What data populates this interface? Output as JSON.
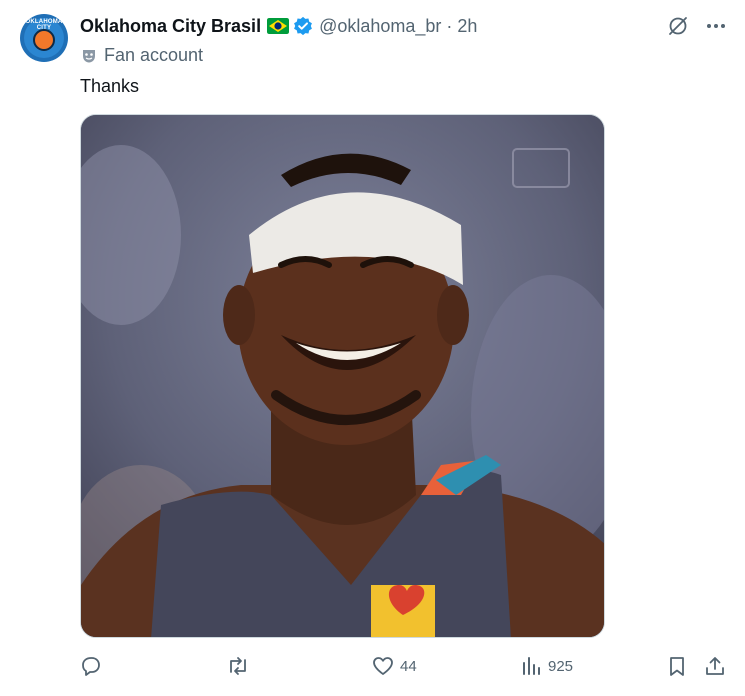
{
  "post": {
    "author": {
      "display_name": "Oklahoma City Brasil",
      "handle": "@oklahoma_br",
      "avatar_text": "OKLAHOMA CITY",
      "flag": "brazil-flag-icon",
      "verified": true
    },
    "separator": "·",
    "time": "2h",
    "label": {
      "icon": "fan-mask-icon",
      "text": "Fan account"
    },
    "text": "Thanks",
    "media": {
      "type": "photo",
      "description_icon": "photo"
    },
    "actions": {
      "reply": {
        "icon": "reply-icon",
        "count": ""
      },
      "repost": {
        "icon": "repost-icon",
        "count": ""
      },
      "like": {
        "icon": "heart-icon",
        "count": "44"
      },
      "views": {
        "icon": "views-icon",
        "count": "925"
      },
      "bookmark": {
        "icon": "bookmark-icon"
      },
      "share": {
        "icon": "share-icon"
      }
    },
    "top_actions": {
      "grok": "grok-icon",
      "more": "more-icon"
    },
    "colors": {
      "text": "#0f1419",
      "secondary": "#536471",
      "verified": "#1d9bf0"
    }
  }
}
